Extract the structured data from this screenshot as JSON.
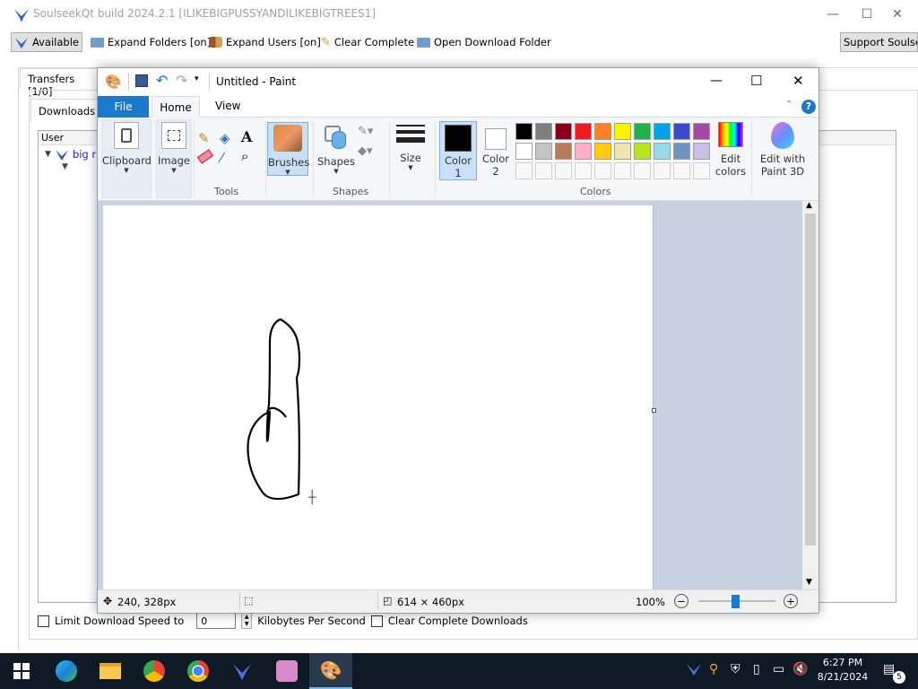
{
  "soulseek": {
    "title": "SoulseekQt build 2024.2.1 [ILIKEBIGPUSSYANDILIKEBIGTREES1]",
    "toolbar": {
      "status": "Available",
      "expand_folders": "Expand Folders [on]",
      "expand_users": "Expand Users [on]",
      "clear_complete": "Clear Complete",
      "open_download_folder": "Open Download Folder",
      "support": "Support Soulseek"
    },
    "transfers_tab": "Transfers [1/0]",
    "downloads_tab": "Downloads",
    "user_header": "User",
    "row_user": "big r",
    "bottom": {
      "limit_label": "Limit Download Speed to",
      "limit_value": "0",
      "units": "Kilobytes Per Second",
      "clear_label": "Clear Complete Downloads"
    }
  },
  "paint": {
    "title": "Untitled - Paint",
    "tabs": {
      "file": "File",
      "home": "Home",
      "view": "View"
    },
    "ribbon": {
      "clipboard": "Clipboard",
      "image": "Image",
      "tools_group": "Tools",
      "brushes": "Brushes",
      "shapes": "Shapes",
      "shapes_group": "Shapes",
      "size": "Size",
      "color1_a": "Color",
      "color1_b": "1",
      "color2_a": "Color",
      "color2_b": "2",
      "colors_group": "Colors",
      "edit_colors_a": "Edit",
      "edit_colors_b": "colors",
      "edit_paint3d_a": "Edit with",
      "edit_paint3d_b": "Paint 3D"
    },
    "palette_row1": [
      "#000000",
      "#7f7f7f",
      "#880015",
      "#ed1c24",
      "#ff7f27",
      "#fff200",
      "#22b14c",
      "#00a2e8",
      "#3f48cc",
      "#a349a4"
    ],
    "palette_row2": [
      "#ffffff",
      "#c3c3c3",
      "#b97a57",
      "#ffaec9",
      "#ffc90e",
      "#efe4b0",
      "#b5e61d",
      "#99d9ea",
      "#7092be",
      "#c8bfe7"
    ],
    "color1": "#000000",
    "color2": "#ffffff",
    "status": {
      "cursor_pos": "240, 328px",
      "canvas_size": "614 × 460px",
      "zoom": "100%"
    }
  },
  "taskbar": {
    "time": "6:27 PM",
    "date": "8/21/2024",
    "notifications": "5"
  }
}
